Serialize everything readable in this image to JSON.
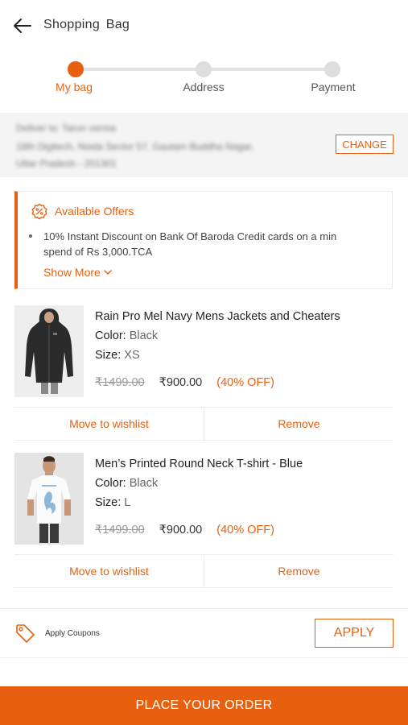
{
  "header": {
    "title": "Shopping  Bag",
    "back_icon": "arrow-left-icon"
  },
  "stepper": {
    "steps": [
      {
        "label": "My bag",
        "active": true
      },
      {
        "label": "Address",
        "active": false
      },
      {
        "label": "Payment",
        "active": false
      }
    ],
    "accent_color": "#e8600f"
  },
  "address": {
    "line1": "Deliver to: Tarun verma",
    "line2": "18th Digitech, Noida Sector 57, Gautam Buddha Nagar,",
    "line3": "Uttar Pradesh - 201301",
    "change_label": "CHANGE"
  },
  "offers": {
    "title": "Available Offers",
    "icon": "percent-badge-icon",
    "items": [
      "10% Instant Discount on Bank Of Baroda Credit cards on a min spend of Rs 3,000.TCA"
    ],
    "show_more_label": "Show More"
  },
  "cart": {
    "items": [
      {
        "name": "Rain Pro Mel Navy Mens Jackets and Cheaters",
        "color_label": "Color:",
        "color": "Black",
        "size_label": "Size:",
        "size": "XS",
        "original_price": "₹1499.00",
        "price": "₹900.00",
        "discount": "(40% OFF)",
        "wishlist_label": "Move to wishlist",
        "remove_label": "Remove"
      },
      {
        "name": "Men’s Printed Round Neck T-shirt - Blue",
        "color_label": "Color:",
        "color": "Black",
        "size_label": "Size:",
        "size": "L",
        "original_price": "₹1499.00",
        "price": "₹900.00",
        "discount": "(40% OFF)",
        "wishlist_label": "Move to wishlist",
        "remove_label": "Remove"
      }
    ]
  },
  "coupons": {
    "label": "Apply Coupons",
    "apply_label": "APPLY",
    "icon": "tag-icon"
  },
  "footer": {
    "place_order_label": "PLACE YOUR ORDER"
  }
}
